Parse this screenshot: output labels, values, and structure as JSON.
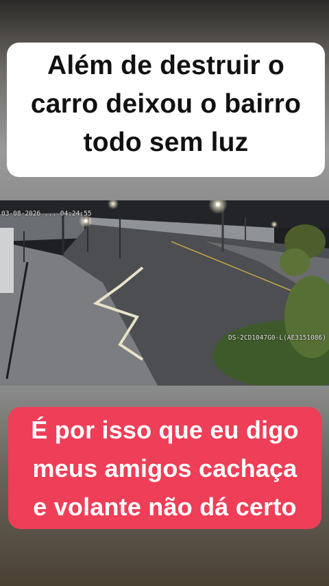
{
  "top_caption": {
    "lines": [
      "Além de destruir o",
      "carro deixou o bairro",
      "todo sem luz"
    ]
  },
  "video": {
    "timestamp": "03-08-2026 ... 04:24:55",
    "camera_id": "DS-2CD1047G0-L(AE3151086)"
  },
  "bottom_caption": {
    "lines": [
      "É por isso que eu digo",
      "meus amigos cachaça",
      "e volante não dá certo"
    ]
  },
  "colors": {
    "top_caption_bg": "#ffffff",
    "bottom_caption_bg": "#ef3e57"
  }
}
